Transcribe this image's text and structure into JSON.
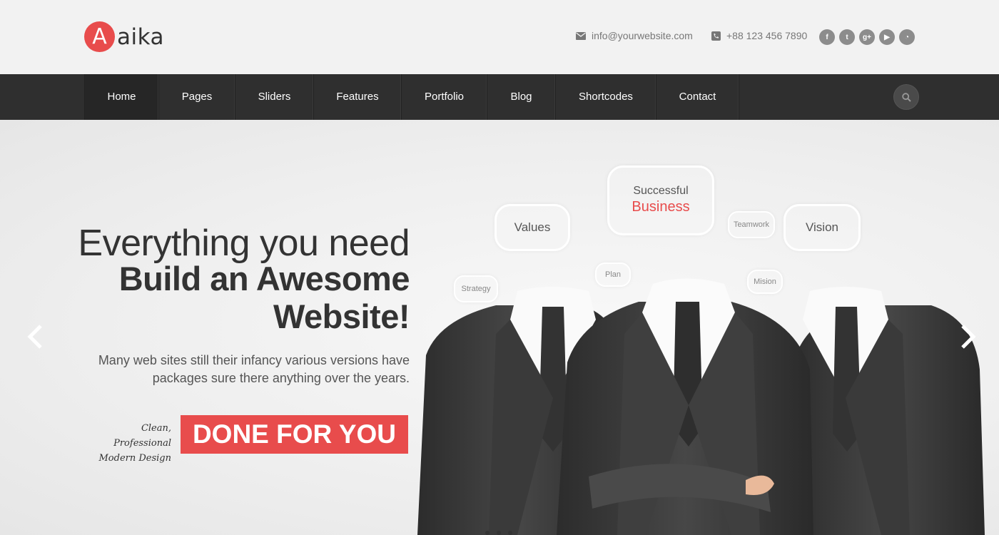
{
  "brand": {
    "mark": "A",
    "name": "aika"
  },
  "contact": {
    "email": "info@yourwebsite.com",
    "phone": "+88 123 456 7890"
  },
  "socials": [
    {
      "icon": "facebook-icon",
      "glyph": "f"
    },
    {
      "icon": "twitter-icon",
      "glyph": "t"
    },
    {
      "icon": "google-plus-icon",
      "glyph": "g+"
    },
    {
      "icon": "youtube-icon",
      "glyph": "▶"
    },
    {
      "icon": "rss-icon",
      "glyph": "◔"
    }
  ],
  "nav": {
    "items": [
      {
        "label": "Home",
        "active": true
      },
      {
        "label": "Pages"
      },
      {
        "label": "Sliders"
      },
      {
        "label": "Features"
      },
      {
        "label": "Portfolio"
      },
      {
        "label": "Blog"
      },
      {
        "label": "Shortcodes"
      },
      {
        "label": "Contact"
      }
    ],
    "search_icon": "search-icon"
  },
  "hero": {
    "headline_light": "Everything you need",
    "headline_bold_1": "Build an Awesome",
    "headline_bold_2": "Website!",
    "subtext_1": "Many web sites still their infancy various versions have",
    "subtext_2": "packages sure there anything over the years.",
    "tagline_1": "Clean, Professional",
    "tagline_2": "Modern Design",
    "cta": "DONE FOR YOU",
    "bubbles": {
      "values": "Values",
      "successful": "Successful",
      "business": "Business",
      "vision": "Vision",
      "strategy": "Strategy",
      "plan": "Plan",
      "teamwork": "Teamwork",
      "mision": "Mision"
    }
  },
  "colors": {
    "accent": "#e84c4c",
    "nav_bg": "#2f2f2f",
    "page_bg": "#f2f2f2"
  }
}
